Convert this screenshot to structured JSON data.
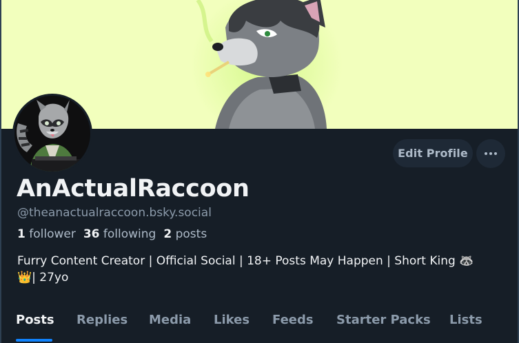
{
  "profile": {
    "display_name": "AnActualRaccoon",
    "handle": "@theanactualraccoon.bsky.social",
    "bio_line1": "Furry Content Creator | Official Social | 18+ Posts May Happen | Short King 🦝",
    "bio_line2": "👑| 27yo"
  },
  "stats": {
    "followers_count": "1",
    "followers_label": "follower",
    "following_count": "36",
    "following_label": "following",
    "posts_count": "2",
    "posts_label": "posts"
  },
  "actions": {
    "edit_profile_label": "Edit Profile",
    "more_icon": "ellipsis-icon"
  },
  "tabs": [
    {
      "label": "Posts",
      "active": true
    },
    {
      "label": "Replies",
      "active": false
    },
    {
      "label": "Media",
      "active": false
    },
    {
      "label": "Likes",
      "active": false
    },
    {
      "label": "Feeds",
      "active": false
    },
    {
      "label": "Starter Packs",
      "active": false
    },
    {
      "label": "Lists",
      "active": false
    }
  ],
  "colors": {
    "background": "#161e27",
    "banner": "#f2ffbd",
    "accent": "#1083fe",
    "button_bg": "#1e2936",
    "text_primary": "#f1f3f5",
    "text_secondary": "#8c9bab"
  }
}
